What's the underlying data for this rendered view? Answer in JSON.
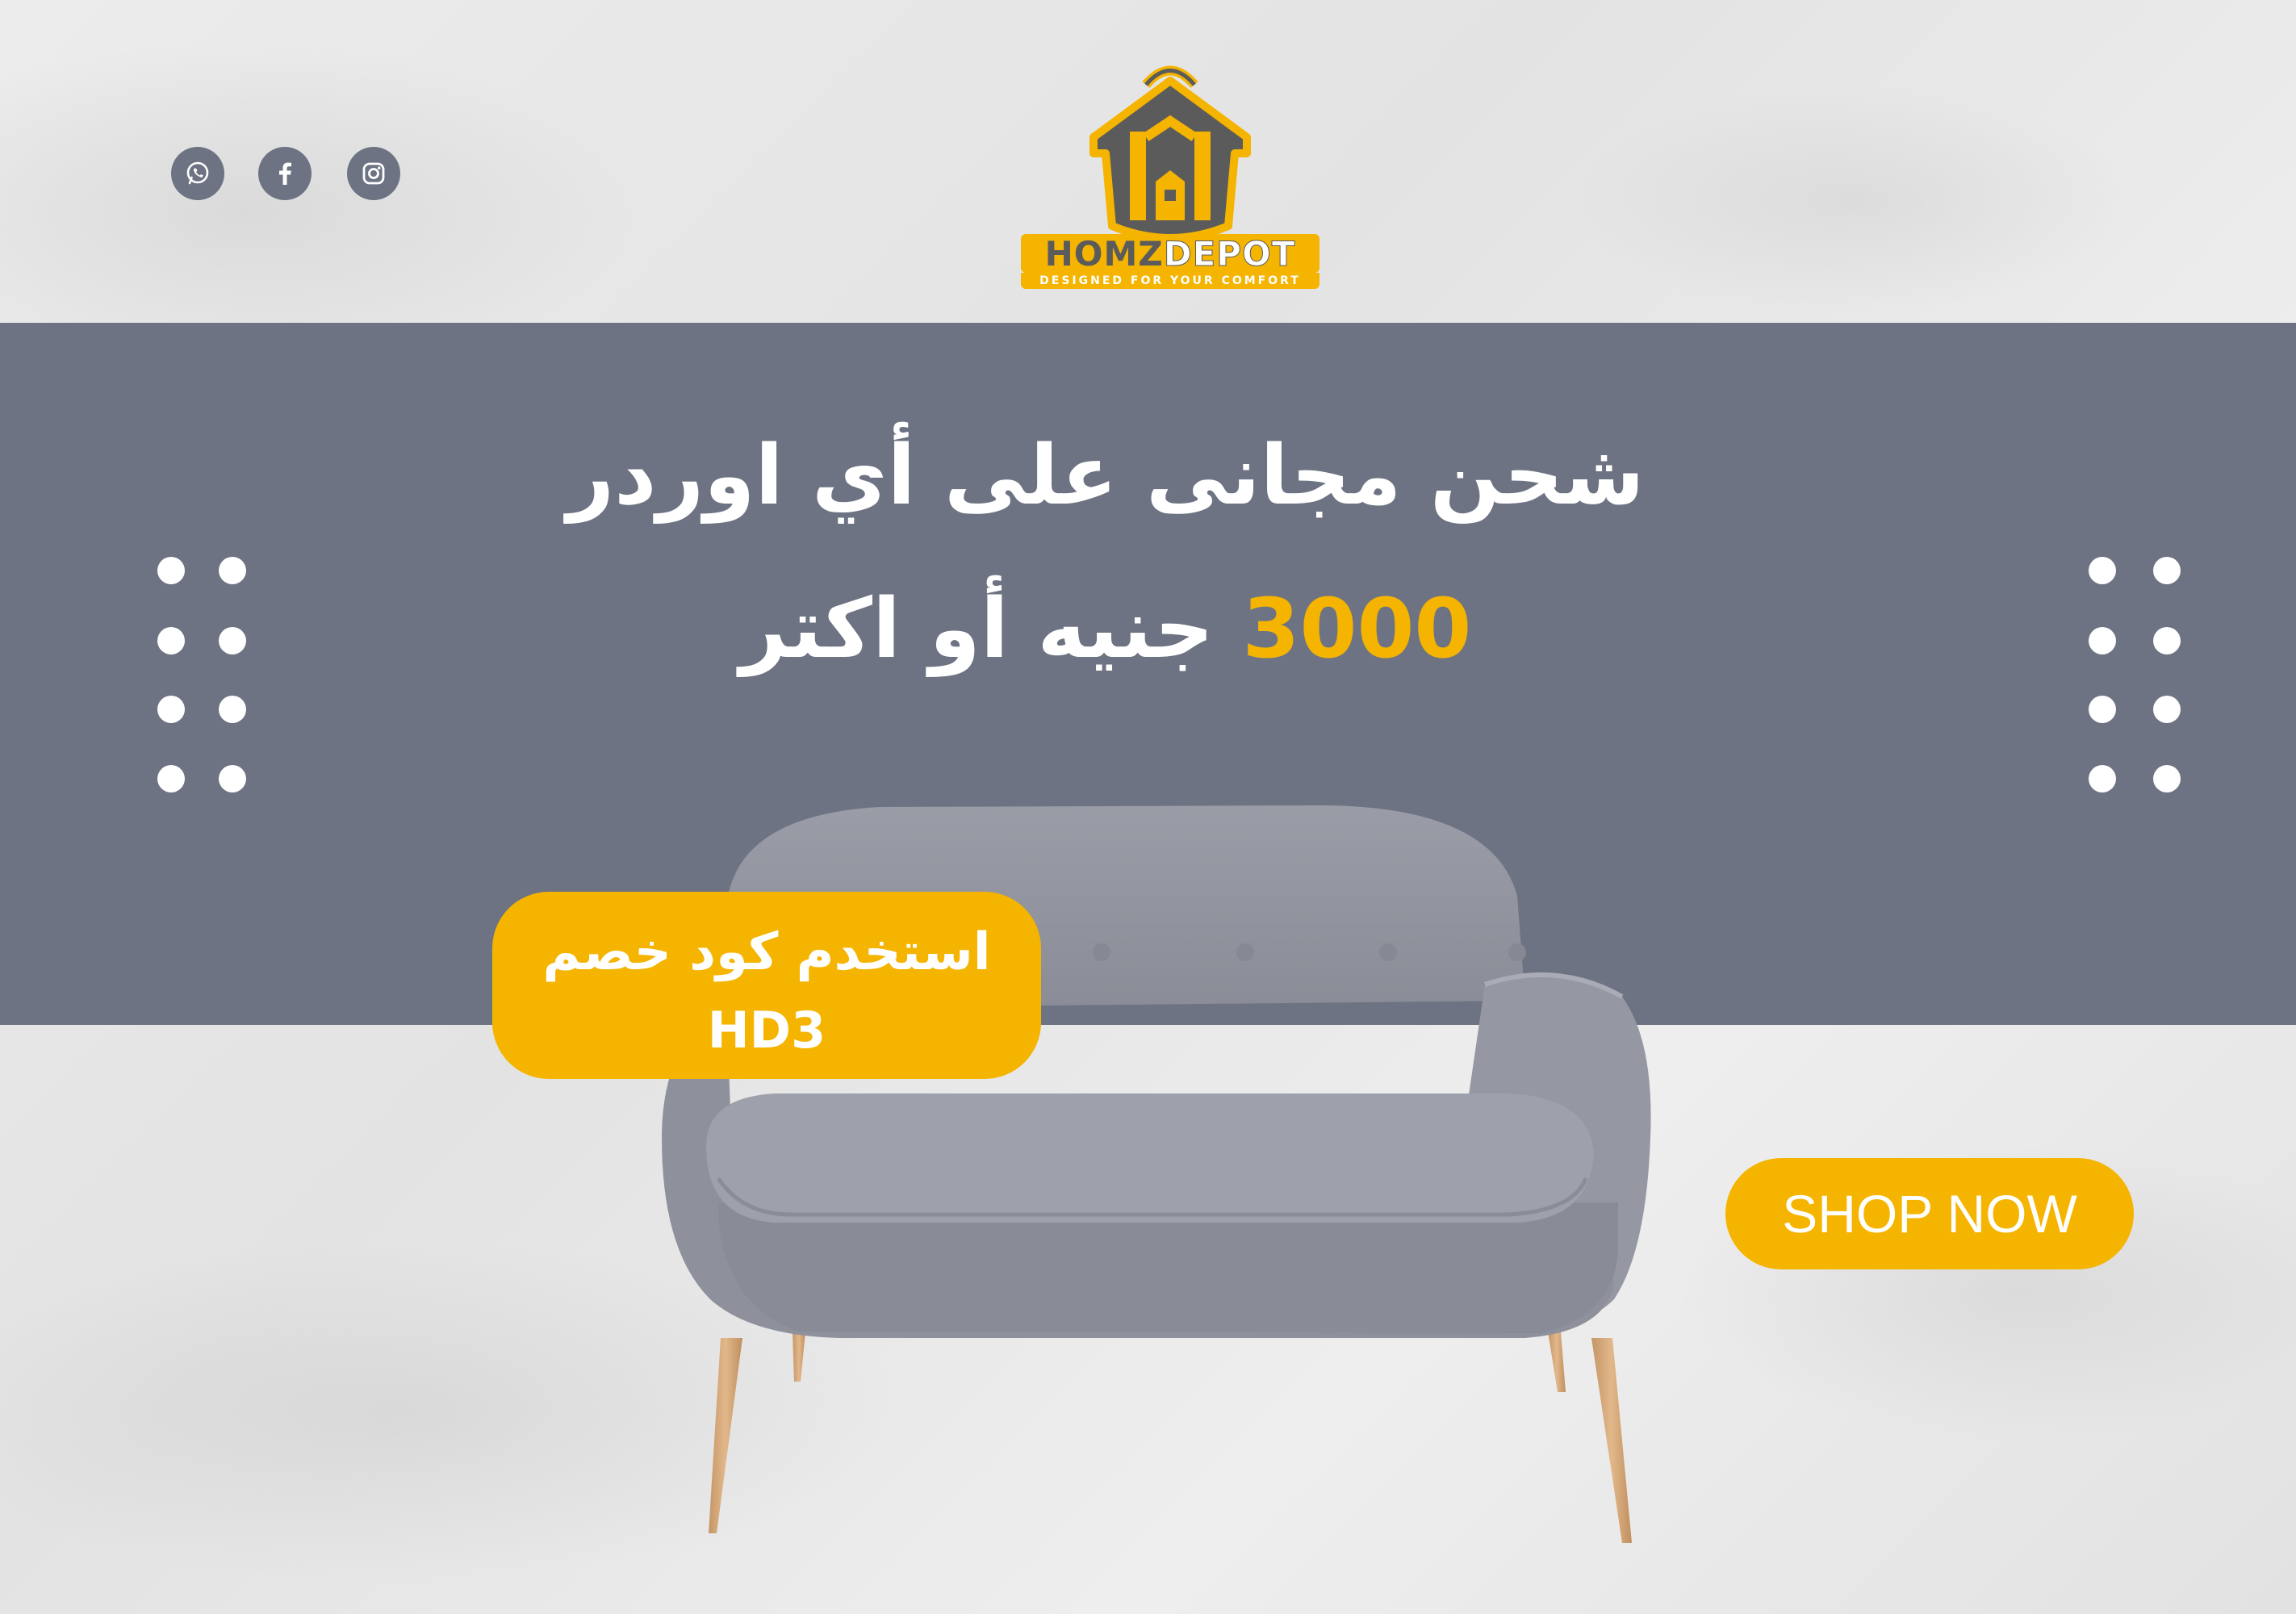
{
  "colors": {
    "accent": "#f4b400",
    "band": "#6d7382",
    "white": "#ffffff"
  },
  "social": [
    {
      "icon": "whatsapp-icon"
    },
    {
      "icon": "facebook-icon"
    },
    {
      "icon": "instagram-icon"
    }
  ],
  "logo": {
    "word_left": "HOMZ",
    "word_right": "DEPOT",
    "tagline": "DESIGNED FOR YOUR COMFORT"
  },
  "headline": {
    "line1": "شحن مجانى على أي اوردر",
    "line2_text": "جنيه أو اكتر",
    "line2_amount": "3000"
  },
  "promo": {
    "line1": "استخدم كود خصم",
    "code": "HD3"
  },
  "cta": {
    "label": "SHOP NOW"
  }
}
